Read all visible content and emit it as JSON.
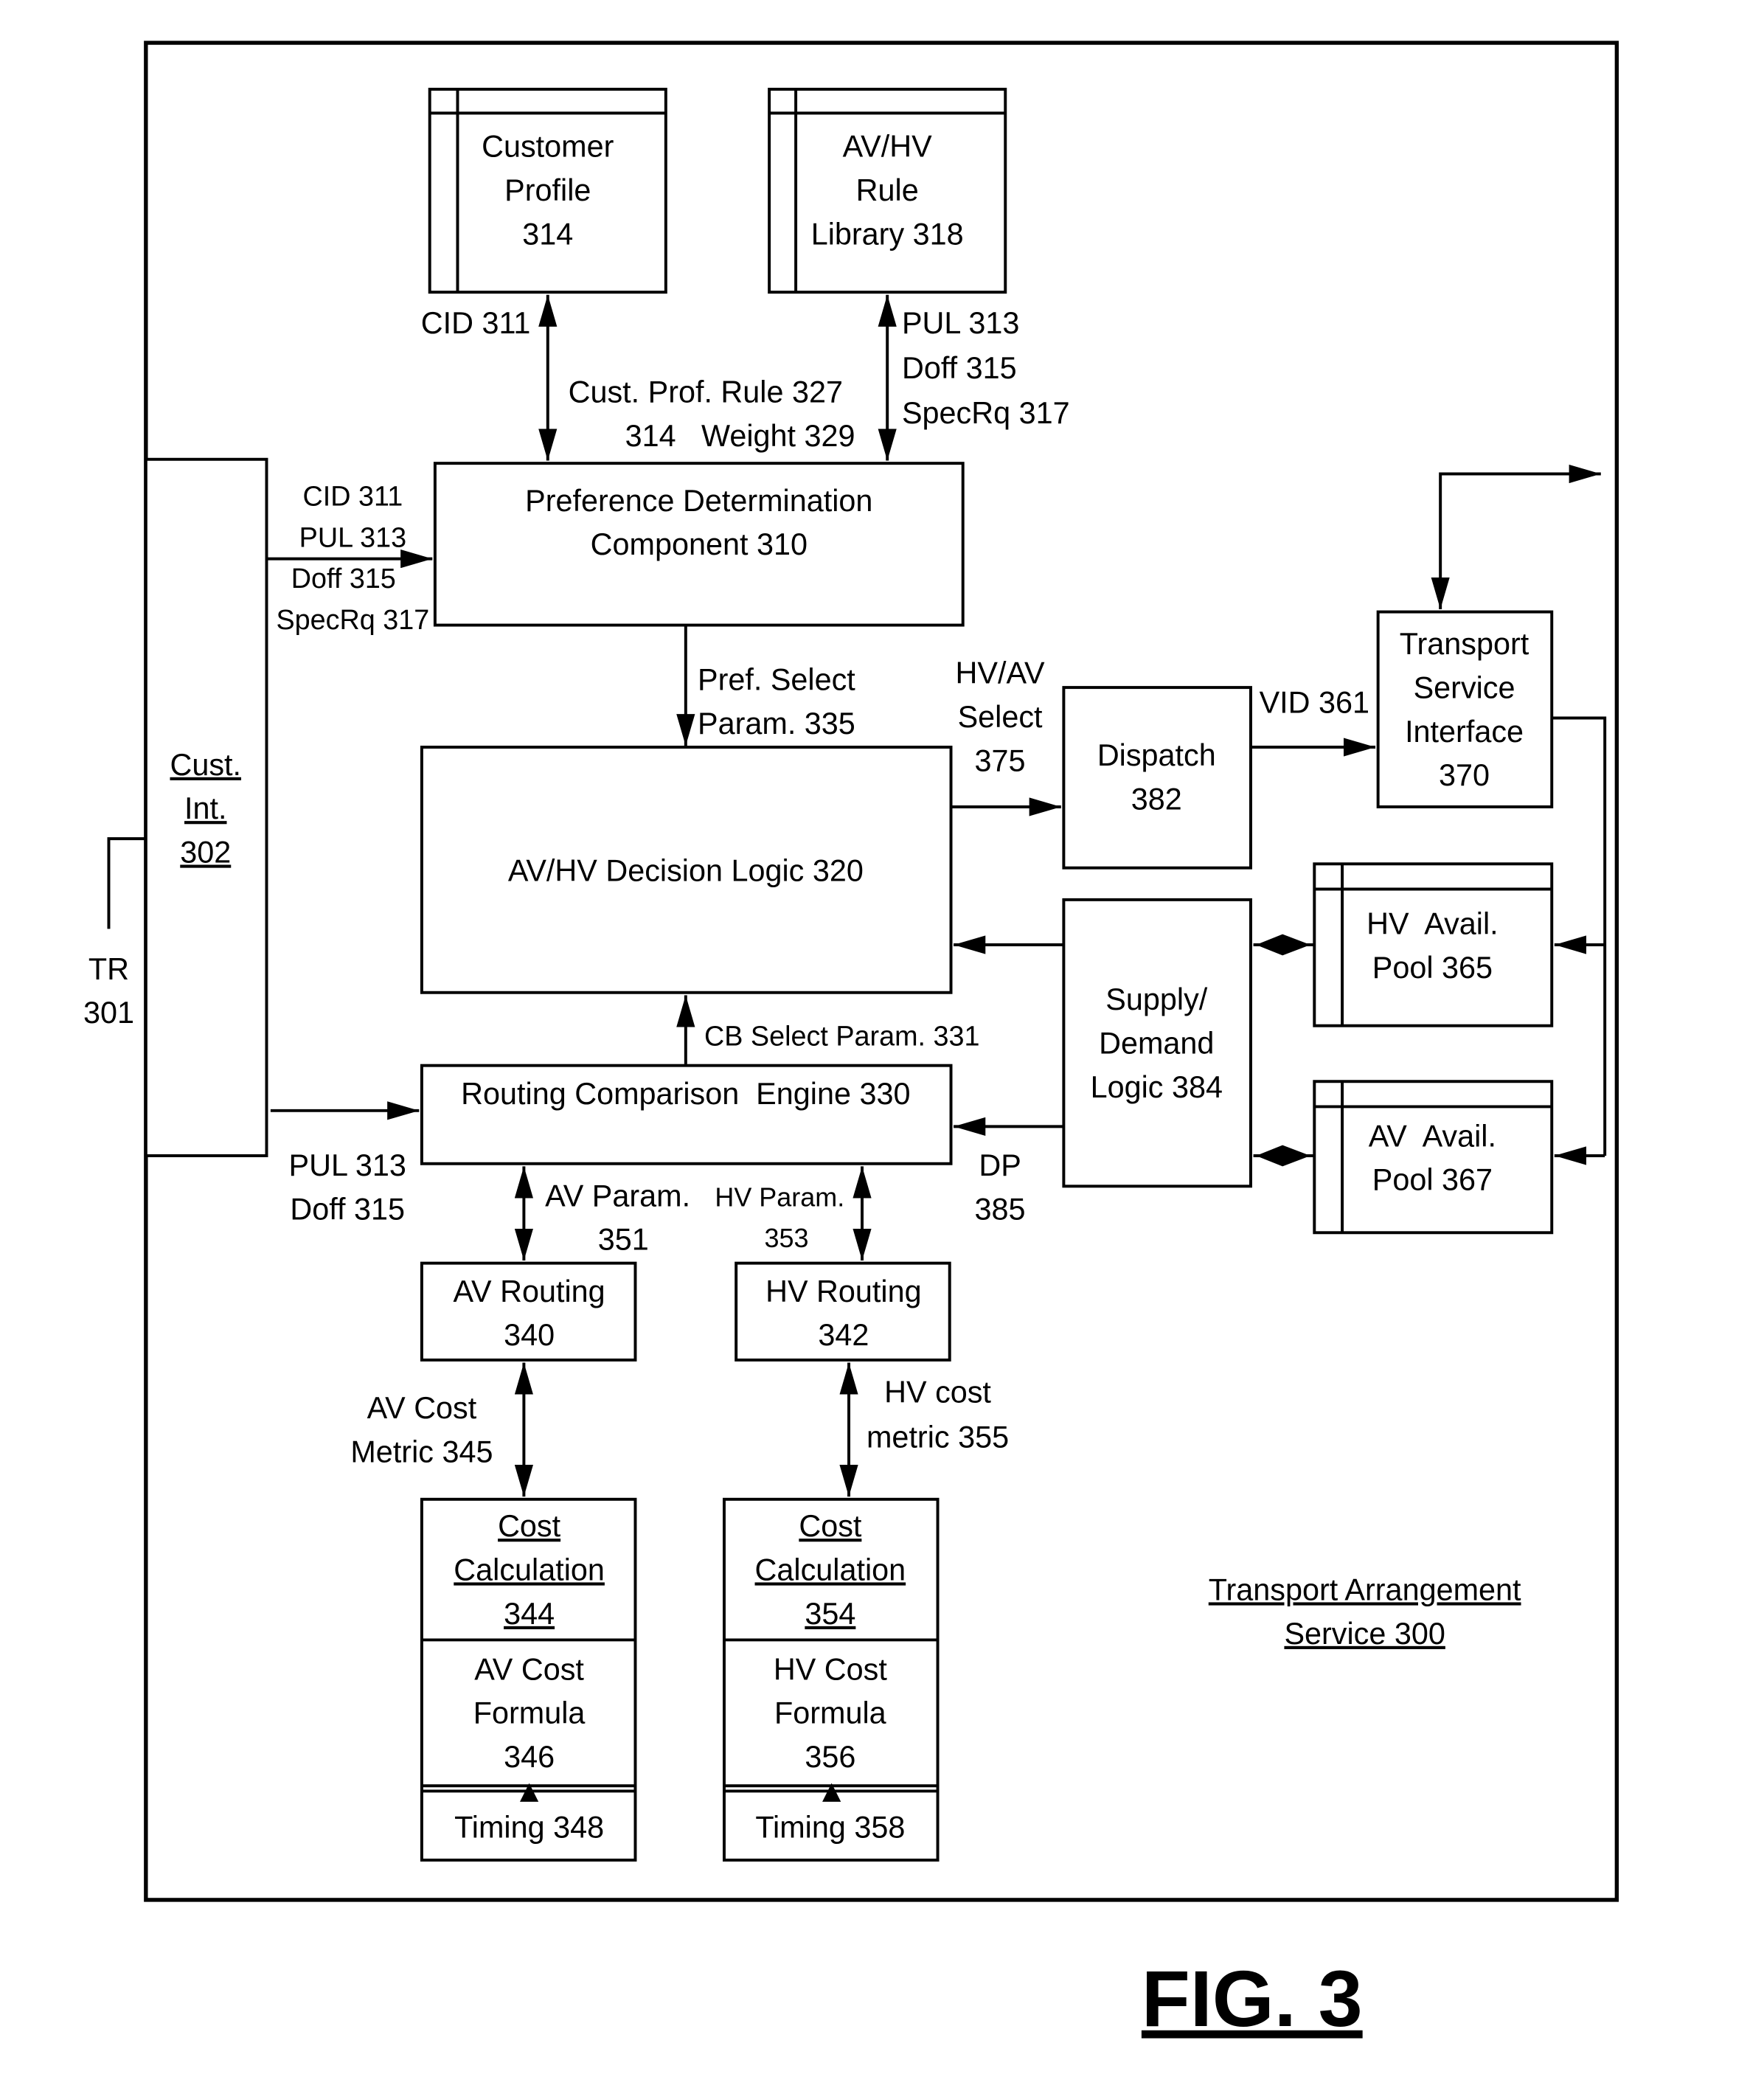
{
  "figure": {
    "title": "FIG. 3",
    "service_label": [
      "Transport Arrangement",
      "Service 300"
    ]
  },
  "components": {
    "customer_profile": [
      "Customer",
      "Profile",
      "314"
    ],
    "rule_library": [
      "AV/HV",
      "Rule",
      "Library 318"
    ],
    "cust_int": [
      "Cust.",
      "Int.",
      "302"
    ],
    "preference": [
      "Preference Determination",
      "Component 310"
    ],
    "decision_logic": [
      "AV/HV Decision Logic 320"
    ],
    "routing_engine": [
      "Routing Comparison  Engine 330"
    ],
    "dispatch": [
      "Dispatch",
      "382"
    ],
    "transport_interface": [
      "Transport",
      "Service",
      "Interface",
      "370"
    ],
    "supply_demand": [
      "Supply/",
      "Demand",
      "Logic 384"
    ],
    "hv_pool": [
      "HV  Avail.",
      "Pool 365"
    ],
    "av_pool": [
      "AV  Avail.",
      "Pool 367"
    ],
    "av_routing": [
      "AV Routing",
      "340"
    ],
    "hv_routing": [
      "HV Routing",
      "342"
    ],
    "av_cost_calc": [
      "Cost",
      "Calculation",
      "344"
    ],
    "av_cost_formula": [
      "AV Cost",
      "Formula",
      "346"
    ],
    "av_timing": [
      "Timing 348"
    ],
    "hv_cost_calc": [
      "Cost",
      "Calculation",
      "354"
    ],
    "hv_cost_formula": [
      "HV Cost",
      "Formula",
      "356"
    ],
    "hv_timing": [
      "Timing 358"
    ]
  },
  "signals": {
    "cid_top": "CID 311",
    "cust_prof_rule": [
      "Cust. Prof. Rule 327",
      "314   Weight 329"
    ],
    "rule_lib_out": [
      "PUL 313",
      "Doff 315",
      "SpecRq 317"
    ],
    "cust_to_pref": [
      "CID 311",
      "PUL 313",
      "Doff 315",
      "SpecRq 317"
    ],
    "tr": [
      "TR",
      "301"
    ],
    "pref_select": [
      "Pref. Select",
      "Param. 335"
    ],
    "hv_av_select": [
      "HV/AV",
      "Select",
      "375"
    ],
    "vid": "VID 361",
    "cb_select": "CB Select Param. 331",
    "pul_doff": [
      "PUL 313",
      "Doff 315"
    ],
    "dp": [
      "DP",
      "385"
    ],
    "av_param": [
      "AV Param.",
      "351"
    ],
    "hv_param": [
      "HV Param.",
      "353"
    ],
    "av_cost_metric": [
      "AV Cost",
      "Metric 345"
    ],
    "hv_cost_metric": [
      "HV cost",
      "metric 355"
    ]
  }
}
